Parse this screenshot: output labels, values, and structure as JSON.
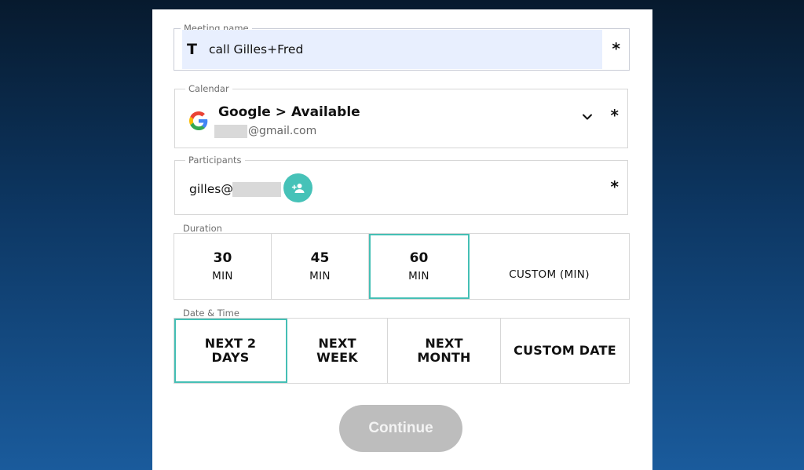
{
  "form": {
    "meeting_name": {
      "label": "Meeting name",
      "value": "call Gilles+Fred",
      "icon": "text-t-icon",
      "required_mark": "*"
    },
    "calendar": {
      "label": "Calendar",
      "provider": "Google",
      "separator": ">",
      "calendar_name": "Available",
      "account_email_visible": "@gmail.com",
      "icon": "google-logo-icon",
      "required_mark": "*"
    },
    "participants": {
      "label": "Participants",
      "value_visible": "gilles@",
      "add_icon": "add-person-icon",
      "required_mark": "*"
    },
    "duration": {
      "label": "Duration",
      "options": [
        {
          "num": "30",
          "unit": "MIN"
        },
        {
          "num": "45",
          "unit": "MIN"
        },
        {
          "num": "60",
          "unit": "MIN"
        },
        {
          "custom": "CUSTOM (MIN)"
        }
      ],
      "selected": "60"
    },
    "date_time": {
      "label": "Date & Time",
      "options": [
        "NEXT 2\nDAYS",
        "NEXT\nWEEK",
        "NEXT\nMONTH",
        "CUSTOM DATE"
      ],
      "selected": "NEXT 2\nDAYS"
    },
    "continue_label": "Continue"
  },
  "colors": {
    "accent": "#45bfb5",
    "input_fill": "#e8effe",
    "button_disabled": "#bdbdbd"
  }
}
